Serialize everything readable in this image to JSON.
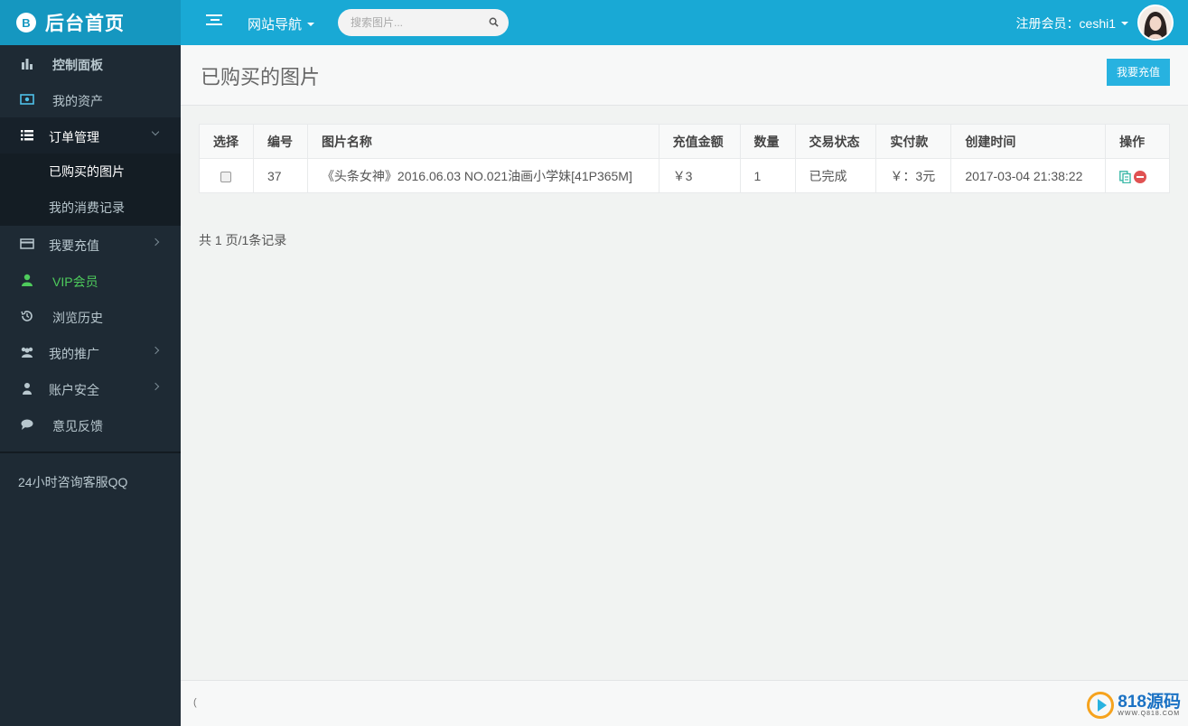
{
  "brand": {
    "icon": "B",
    "title": "后台首页"
  },
  "topbar": {
    "site_nav": "网站导航",
    "search_placeholder": "搜索图片...",
    "user_label": "注册会员：ceshi1"
  },
  "sidebar": {
    "items": [
      {
        "label": "控制面板",
        "icon": "bar-chart-icon"
      },
      {
        "label": "我的资产",
        "icon": "money-icon"
      },
      {
        "label": "订单管理",
        "icon": "list-icon"
      },
      {
        "label": "我要充值",
        "icon": "credit-card-icon"
      },
      {
        "label": "VIP会员",
        "icon": "user-icon"
      },
      {
        "label": "浏览历史",
        "icon": "history-icon"
      },
      {
        "label": "我的推广",
        "icon": "users-icon"
      },
      {
        "label": "账户安全",
        "icon": "user-shield-icon"
      },
      {
        "label": "意见反馈",
        "icon": "comment-icon"
      }
    ],
    "submenu": [
      "已购买的图片",
      "我的消费记录"
    ],
    "qq_text": "24小时咨询客服QQ"
  },
  "page": {
    "title": "已购买的图片",
    "recharge_button": "我要充值"
  },
  "table": {
    "headers": [
      "选择",
      "编号",
      "图片名称",
      "充值金额",
      "数量",
      "交易状态",
      "实付款",
      "创建时间",
      "操作"
    ],
    "rows": [
      {
        "id": "37",
        "name": "《头条女神》2016.06.03 NO.021油画小学妹[41P365M]",
        "amount": "￥3",
        "quantity": "1",
        "status": "已完成",
        "paid": "￥：3元",
        "created": "2017-03-04 21:38:22"
      }
    ]
  },
  "pager": "共 1 页/1条记录",
  "footer": {
    "text": "(",
    "watermark_brand": "818源码",
    "watermark_url": "WWW.Q818.COM"
  },
  "colors": {
    "topbar": "#19a9d5",
    "brand": "#1597c0",
    "sidebar": "#1e2a34",
    "vip": "#4ecb5c",
    "button": "#27b2e0"
  }
}
